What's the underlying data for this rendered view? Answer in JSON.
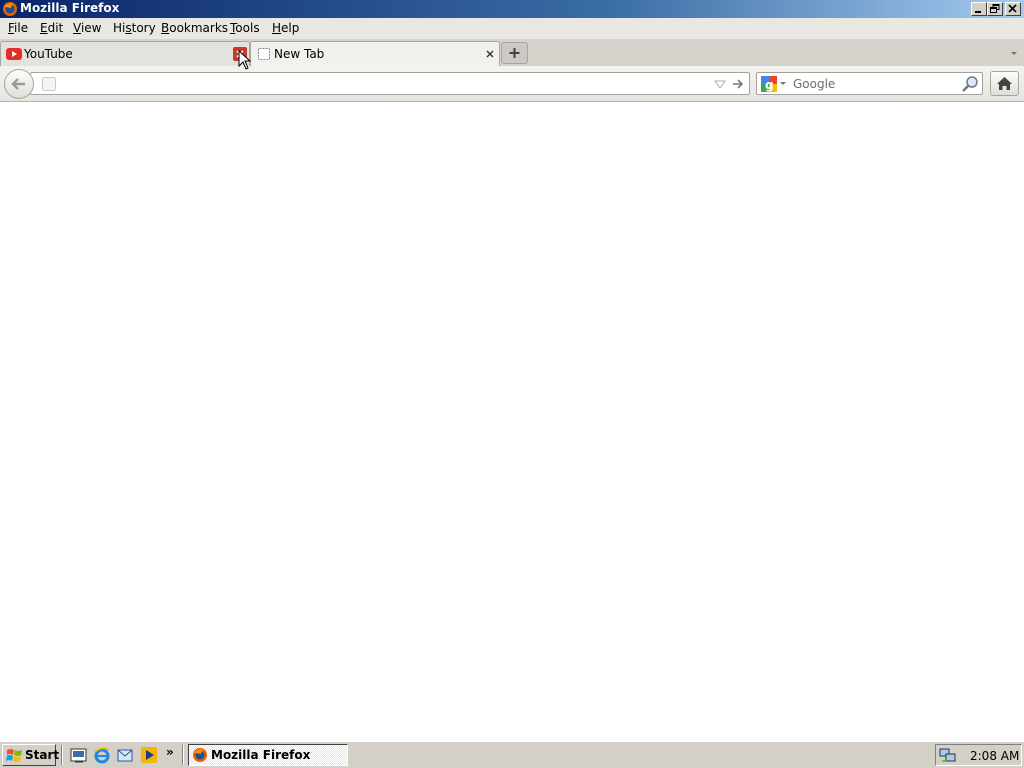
{
  "window": {
    "title": "Mozilla Firefox"
  },
  "menu": {
    "items": [
      {
        "label_pre": "",
        "label_u": "F",
        "label_post": "ile"
      },
      {
        "label_pre": "",
        "label_u": "E",
        "label_post": "dit"
      },
      {
        "label_pre": "",
        "label_u": "V",
        "label_post": "iew"
      },
      {
        "label_pre": "Hi",
        "label_u": "s",
        "label_post": "tory"
      },
      {
        "label_pre": "",
        "label_u": "B",
        "label_post": "ookmarks"
      },
      {
        "label_pre": "",
        "label_u": "T",
        "label_post": "ools"
      },
      {
        "label_pre": "",
        "label_u": "H",
        "label_post": "elp"
      }
    ]
  },
  "tabs": [
    {
      "label": "YouTube",
      "icon": "youtube-icon",
      "close_hover": true
    },
    {
      "label": "New Tab",
      "icon": "blank-page-icon",
      "close_hover": false
    }
  ],
  "urlbar": {
    "value": "",
    "placeholder": ""
  },
  "searchbar": {
    "engine": "Google",
    "placeholder": "Google"
  },
  "taskbar": {
    "start_label": "Start",
    "task_label": "Mozilla Firefox",
    "clock": "2:08 AM"
  },
  "colors": {
    "title_gradient_start": "#0a246a",
    "title_gradient_end": "#a6caf0",
    "youtube_red": "#e52d27",
    "tab_close_hover": "#c9392b"
  }
}
